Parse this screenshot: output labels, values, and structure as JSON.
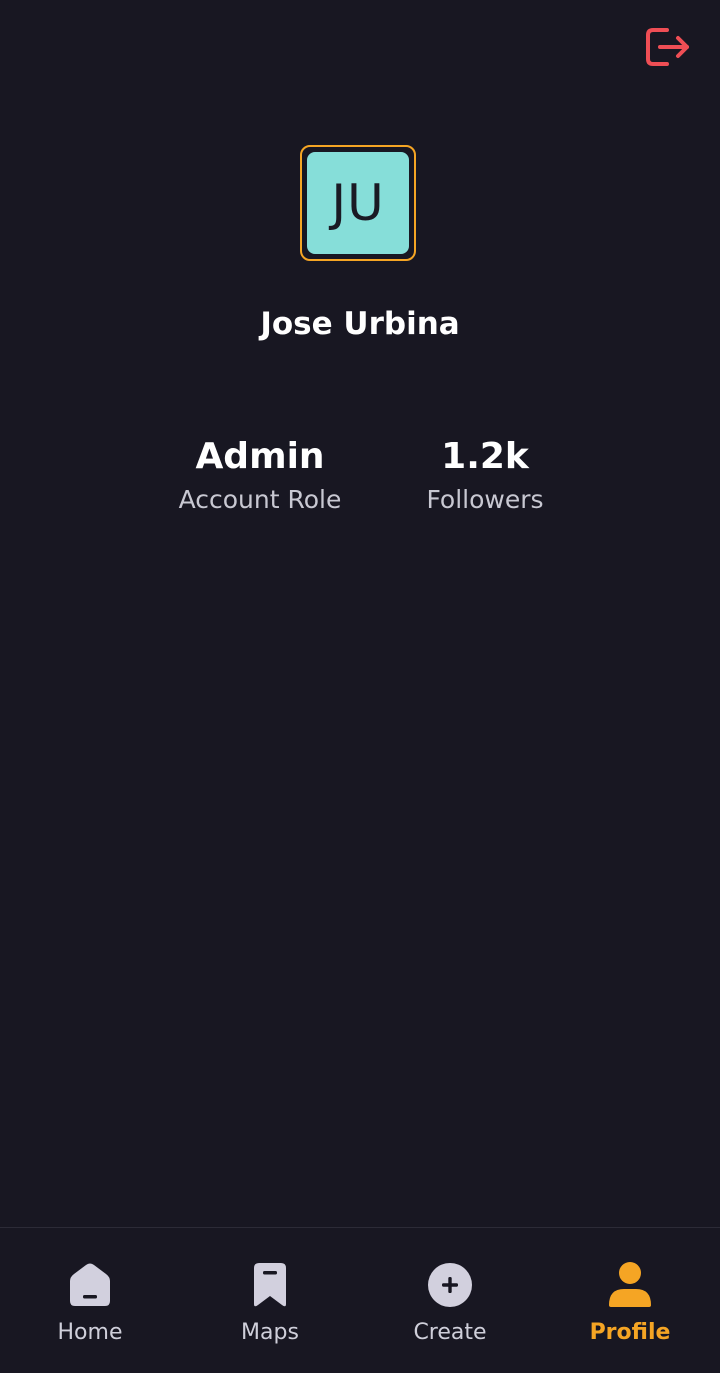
{
  "colors": {
    "background": "#181722",
    "accent": "#f5a524",
    "logout": "#ef4e55",
    "avatar_bg": "#86ded9",
    "icon_inactive": "#d2d0de",
    "text_secondary": "#c8c8d2"
  },
  "header": {
    "logout_icon": "logout-icon"
  },
  "profile": {
    "avatar_initials": "JU",
    "name": "Jose Urbina"
  },
  "stats": [
    {
      "value": "Admin",
      "label": "Account Role"
    },
    {
      "value": "1.2k",
      "label": "Followers"
    }
  ],
  "nav": {
    "items": [
      {
        "label": "Home",
        "icon": "home-icon",
        "active": false
      },
      {
        "label": "Maps",
        "icon": "bookmark-icon",
        "active": false
      },
      {
        "label": "Create",
        "icon": "add-circle-icon",
        "active": false
      },
      {
        "label": "Profile",
        "icon": "user-icon",
        "active": true
      }
    ]
  }
}
